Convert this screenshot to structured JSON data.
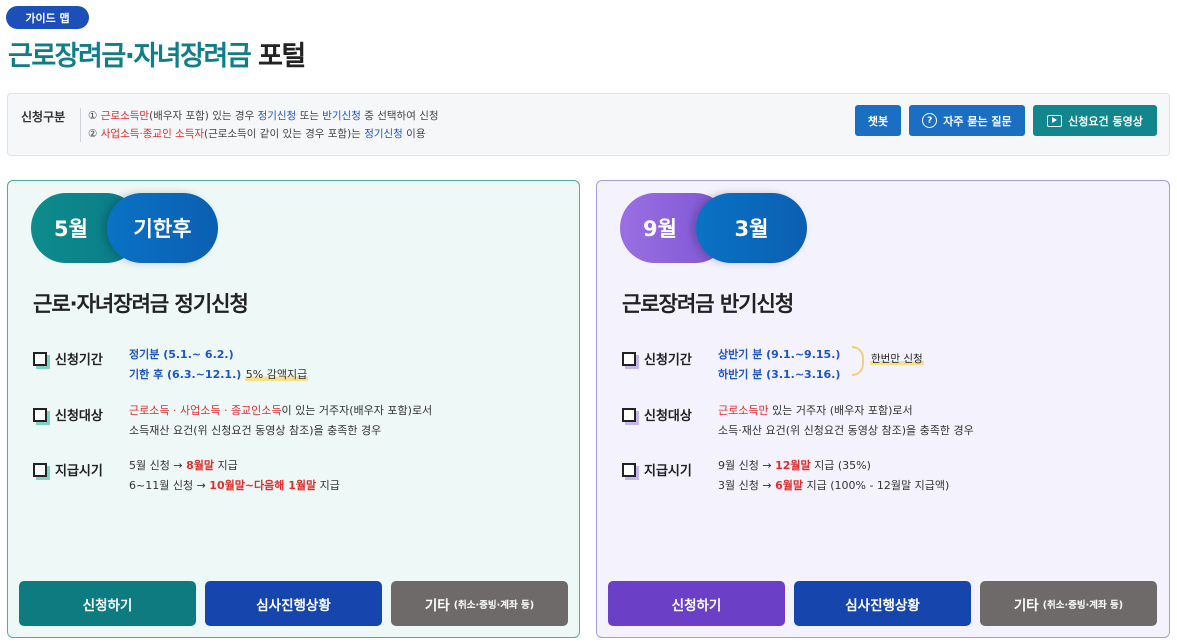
{
  "header": {
    "guide_badge": "가이드 맵",
    "title_colored": "근로장려금·자녀장려금",
    "title_plain": "포털"
  },
  "info": {
    "label": "신청구분",
    "line1": {
      "num": "①",
      "red": "근로소득만",
      "t1": "(배우자 포함) 있는 경우",
      "blue1": "정기신청",
      "t2": "또는",
      "blue2": "반기신청",
      "t3": "중 선택하여 신청"
    },
    "line2": {
      "num": "②",
      "red": "사업소득·종교인 소득자",
      "t1": "(근로소득이 같이 있는 경우 포함)는",
      "blue": "정기신청",
      "t2": "이용"
    },
    "buttons": {
      "chatbot": "챗봇",
      "faq": "자주 묻는 질문",
      "video": "신청요건 동영상"
    }
  },
  "left_card": {
    "pill_a": "5월",
    "pill_b": "기한후",
    "title": "근로·자녀장려금 정기신청",
    "period": {
      "label": "신청기간",
      "line1": "정기분 (5.1.~ 6.2.)",
      "line2": "기한 후 (6.3.~12.1.)",
      "note": "5% 감액지급"
    },
    "target": {
      "label": "신청대상",
      "red": "근로소득 · 사업소득 · 종교인소득",
      "t1": "이 있는 거주자(배우자 포함)로서",
      "line2": "소득재산 요건(위 신청요건 동영상 참조)을 충족한 경우"
    },
    "payment": {
      "label": "지급시기",
      "l1_pre": "5월 신청 →",
      "l1_red": "8월말",
      "l1_post": "지급",
      "l2_pre": "6~11월 신청 →",
      "l2_red": "10월말~다음해 1월말",
      "l2_post": "지급"
    },
    "buttons": {
      "apply": "신청하기",
      "status": "심사진행상황",
      "etc": "기타",
      "etc_sub": "(취소·증빙·계좌 등)"
    }
  },
  "right_card": {
    "pill_a": "9월",
    "pill_b": "3월",
    "title": "근로장려금 반기신청",
    "period": {
      "label": "신청기간",
      "line1": "상반기 분 (9.1.~9.15.)",
      "line2": "하반기 분 (3.1.~3.16.)",
      "note": "한번만 신청"
    },
    "target": {
      "label": "신청대상",
      "red": "근로소득만",
      "t1": "있는 거주자 (배우자 포함)로서",
      "line2": "소득·재산 요건(위 신청요건 동영상 참조)을 충족한 경우"
    },
    "payment": {
      "label": "지급시기",
      "l1_pre": "9월 신청 →",
      "l1_red": "12월말",
      "l1_post": "지급 (35%)",
      "l2_pre": "3월 신청 →",
      "l2_red": "6월말",
      "l2_post": "지급 (100% - 12월말 지급액)"
    },
    "buttons": {
      "apply": "신청하기",
      "status": "심사진행상황",
      "etc": "기타",
      "etc_sub": "(취소·증빙·계좌 등)"
    }
  }
}
